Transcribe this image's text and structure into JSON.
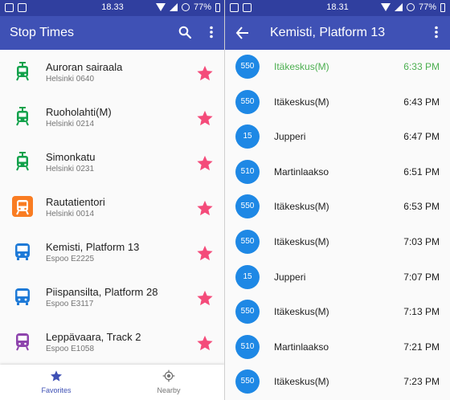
{
  "colors": {
    "primary": "#3F51B5",
    "primary_dark": "#303F9F",
    "accent_star": "#F44B7A",
    "tram": "#12A14B",
    "train": "#8E44AD",
    "metro": "#F97C22",
    "bus": "#1E7AD7",
    "badge": "#1E88E5",
    "next_departure": "#4CAF50"
  },
  "left": {
    "statusbar": {
      "time": "18.33",
      "battery": "77%"
    },
    "appbar": {
      "title": "Stop Times",
      "icons": [
        "search-icon",
        "more-vert-icon"
      ]
    },
    "stops": [
      {
        "name": "Auroran sairaala",
        "code": "Helsinki 0640",
        "type": "tram"
      },
      {
        "name": "Ruoholahti(M)",
        "code": "Helsinki 0214",
        "type": "tram"
      },
      {
        "name": "Simonkatu",
        "code": "Helsinki 0231",
        "type": "tram"
      },
      {
        "name": "Rautatientori",
        "code": "Helsinki 0014",
        "type": "metro"
      },
      {
        "name": "Kemisti, Platform 13",
        "code": "Espoo E2225",
        "type": "bus"
      },
      {
        "name": "Piispansilta, Platform 28",
        "code": "Espoo E3117",
        "type": "bus"
      },
      {
        "name": "Leppävaara, Track 2",
        "code": "Espoo E1058",
        "type": "train"
      }
    ],
    "bottom_nav": [
      {
        "label": "Favorites",
        "icon": "star-icon",
        "active": true
      },
      {
        "label": "Nearby",
        "icon": "gps-icon",
        "active": false
      }
    ]
  },
  "right": {
    "statusbar": {
      "time": "18.31",
      "battery": "77%"
    },
    "appbar": {
      "title": "Kemisti, Platform 13",
      "icons": [
        "back-arrow-icon",
        "more-vert-icon"
      ]
    },
    "departures": [
      {
        "route": "550",
        "destination": "Itäkeskus(M)",
        "time": "6:33 PM"
      },
      {
        "route": "550",
        "destination": "Itäkeskus(M)",
        "time": "6:43 PM"
      },
      {
        "route": "15",
        "destination": "Jupperi",
        "time": "6:47 PM"
      },
      {
        "route": "510",
        "destination": "Martinlaakso",
        "time": "6:51 PM"
      },
      {
        "route": "550",
        "destination": "Itäkeskus(M)",
        "time": "6:53 PM"
      },
      {
        "route": "550",
        "destination": "Itäkeskus(M)",
        "time": "7:03 PM"
      },
      {
        "route": "15",
        "destination": "Jupperi",
        "time": "7:07 PM"
      },
      {
        "route": "550",
        "destination": "Itäkeskus(M)",
        "time": "7:13 PM"
      },
      {
        "route": "510",
        "destination": "Martinlaakso",
        "time": "7:21 PM"
      },
      {
        "route": "550",
        "destination": "Itäkeskus(M)",
        "time": "7:23 PM"
      }
    ]
  }
}
